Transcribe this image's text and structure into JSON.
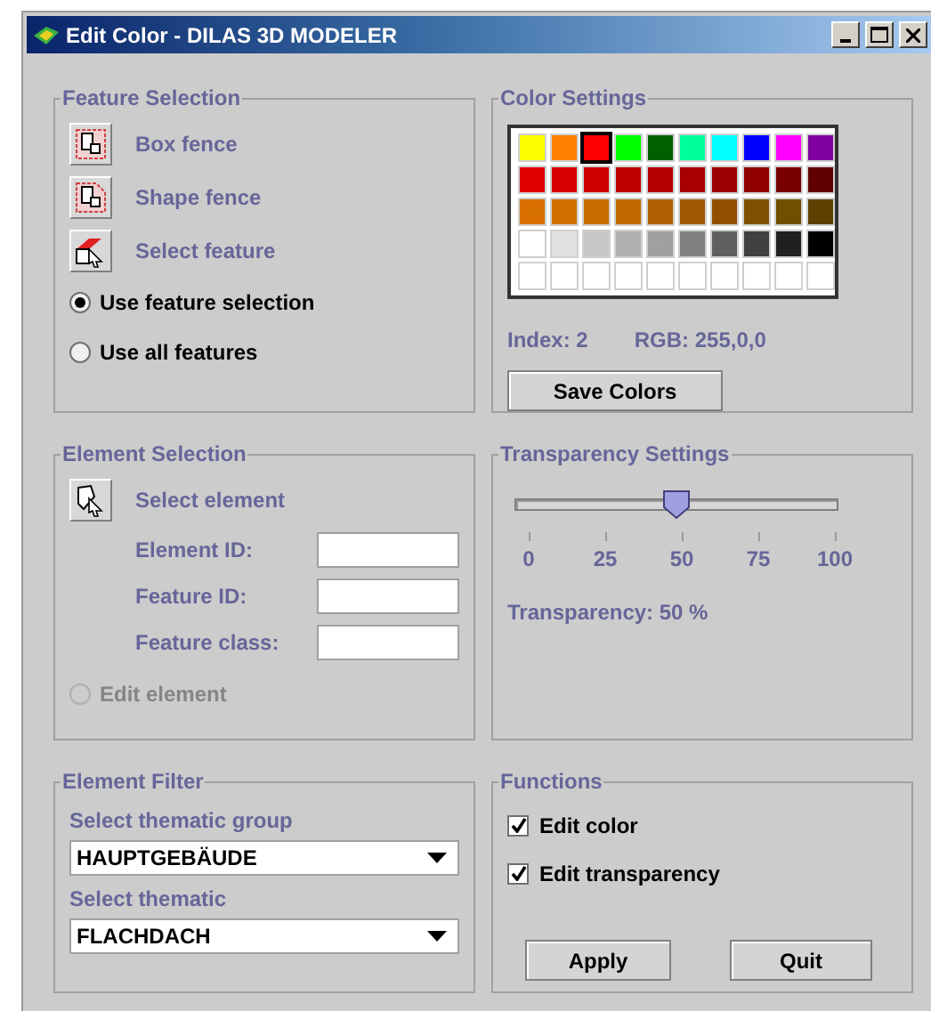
{
  "window": {
    "title": "Edit Color - DILAS 3D MODELER"
  },
  "feature_selection": {
    "title": "Feature Selection",
    "tools": [
      {
        "kind": "box",
        "label": "Box fence"
      },
      {
        "kind": "shape",
        "label": "Shape fence"
      },
      {
        "kind": "pick",
        "label": "Select feature"
      }
    ],
    "options": [
      {
        "label": "Use feature selection",
        "selected": true
      },
      {
        "label": "Use all features",
        "selected": false
      }
    ]
  },
  "color_settings": {
    "title": "Color Settings",
    "palette": [
      [
        {
          "color": "#ffff00",
          "selected": false
        },
        {
          "color": "#ff8000",
          "selected": false
        },
        {
          "color": "#ff0000",
          "selected": true
        },
        {
          "color": "#00ff00",
          "selected": false
        },
        {
          "color": "#006000",
          "selected": false
        },
        {
          "color": "#00ff99",
          "selected": false
        },
        {
          "color": "#00ffff",
          "selected": false
        },
        {
          "color": "#0000ff",
          "selected": false
        },
        {
          "color": "#ff00ff",
          "selected": false
        },
        {
          "color": "#8000a0",
          "selected": false
        }
      ],
      [
        {
          "color": "#e00000",
          "selected": false
        },
        {
          "color": "#d80000",
          "selected": false
        },
        {
          "color": "#cc0000",
          "selected": false
        },
        {
          "color": "#c00000",
          "selected": false
        },
        {
          "color": "#b40000",
          "selected": false
        },
        {
          "color": "#a80000",
          "selected": false
        },
        {
          "color": "#9c0000",
          "selected": false
        },
        {
          "color": "#900000",
          "selected": false
        },
        {
          "color": "#780000",
          "selected": false
        },
        {
          "color": "#600000",
          "selected": false
        }
      ],
      [
        {
          "color": "#d87000",
          "selected": false
        },
        {
          "color": "#d07000",
          "selected": false
        },
        {
          "color": "#c86c00",
          "selected": false
        },
        {
          "color": "#c06800",
          "selected": false
        },
        {
          "color": "#b06000",
          "selected": false
        },
        {
          "color": "#a05800",
          "selected": false
        },
        {
          "color": "#905000",
          "selected": false
        },
        {
          "color": "#805000",
          "selected": false
        },
        {
          "color": "#705000",
          "selected": false
        },
        {
          "color": "#604000",
          "selected": false
        }
      ],
      [
        {
          "color": "#ffffff",
          "selected": false
        },
        {
          "color": "#e0e0e0",
          "selected": false
        },
        {
          "color": "#c8c8c8",
          "selected": false
        },
        {
          "color": "#b0b0b0",
          "selected": false
        },
        {
          "color": "#a0a0a0",
          "selected": false
        },
        {
          "color": "#808080",
          "selected": false
        },
        {
          "color": "#606060",
          "selected": false
        },
        {
          "color": "#404040",
          "selected": false
        },
        {
          "color": "#202020",
          "selected": false
        },
        {
          "color": "#000000",
          "selected": false
        }
      ],
      [
        {
          "color": "#ffffff",
          "selected": false
        },
        {
          "color": "#ffffff",
          "selected": false
        },
        {
          "color": "#ffffff",
          "selected": false
        },
        {
          "color": "#ffffff",
          "selected": false
        },
        {
          "color": "#ffffff",
          "selected": false
        },
        {
          "color": "#ffffff",
          "selected": false
        },
        {
          "color": "#ffffff",
          "selected": false
        },
        {
          "color": "#ffffff",
          "selected": false
        },
        {
          "color": "#ffffff",
          "selected": false
        },
        {
          "color": "#ffffff",
          "selected": false
        }
      ]
    ],
    "index": "Index: 2",
    "rgb": "RGB: 255,0,0",
    "save_button": "Save Colors"
  },
  "element_selection": {
    "title": "Element Selection",
    "tool": {
      "kind": "element",
      "label": "Select element"
    },
    "fields": [
      {
        "label": "Element ID:"
      },
      {
        "label": "Feature ID:"
      },
      {
        "label": "Feature class:"
      }
    ],
    "edit_option": {
      "label": "Edit element",
      "selected": false,
      "disabled": true
    }
  },
  "transparency": {
    "title": "Transparency Settings",
    "level": 0.5,
    "ticks": [
      "0",
      "25",
      "50",
      "75",
      "100"
    ],
    "reading": "Transparency: 50 %"
  },
  "element_filter": {
    "title": "Element Filter",
    "selects": [
      {
        "label": "Select thematic group",
        "value": "HAUPTGEBÄUDE"
      },
      {
        "label": "Select thematic",
        "value": "FLACHDACH"
      }
    ]
  },
  "functions": {
    "title": "Functions",
    "options": [
      {
        "label": "Edit color",
        "checked": true
      },
      {
        "label": "Edit transparency",
        "checked": true
      }
    ],
    "buttons": [
      "Apply",
      "Quit"
    ]
  }
}
